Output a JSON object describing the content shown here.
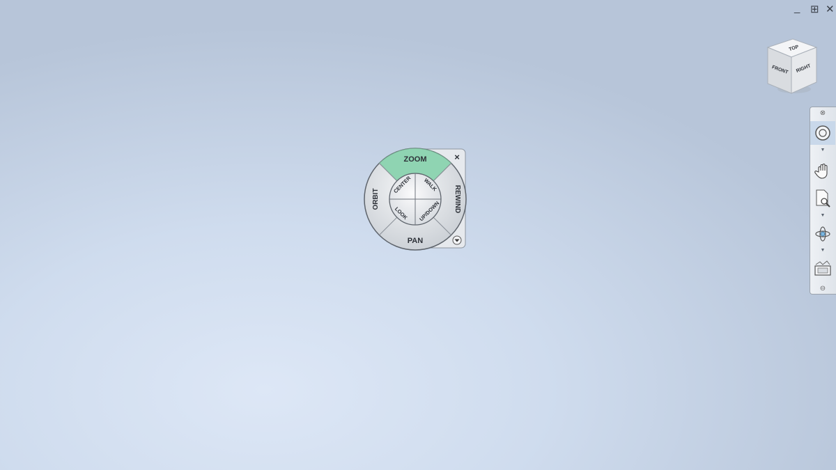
{
  "window_controls": {
    "minimize": "_",
    "restore": "⊞",
    "close": "✕"
  },
  "view_cube": {
    "top": "TOP",
    "front": "FRONT",
    "right": "RIGHT"
  },
  "steering_wheel": {
    "outer": {
      "zoom": "ZOOM",
      "rewind": "REWIND",
      "pan": "PAN",
      "orbit": "ORBIT"
    },
    "inner": {
      "center": "CENTER",
      "walk": "WALK",
      "look": "LOOK",
      "up_down": "UP/DOWN"
    },
    "close_glyph": "×",
    "highlight_color": "#8fd4b2"
  },
  "nav_bar": {
    "tools": [
      "full-navigation-wheel",
      "pan",
      "zoom-window",
      "orbit",
      "view-face"
    ],
    "close_glyph": "⊗",
    "collapse_glyph": "⊖"
  }
}
